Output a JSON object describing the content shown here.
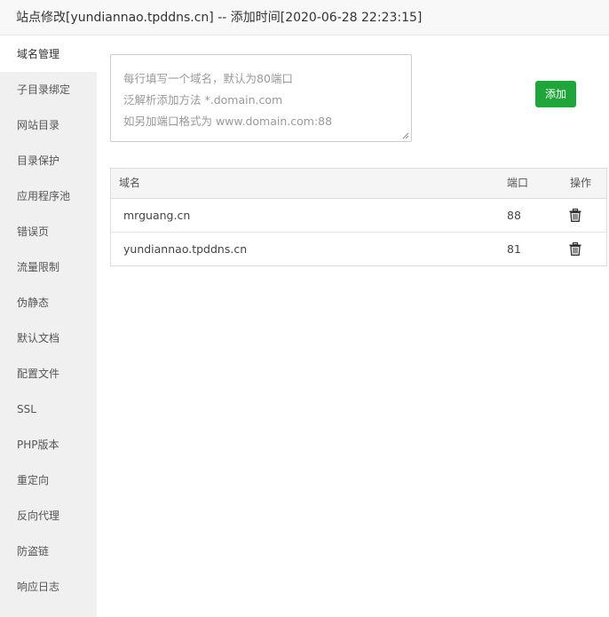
{
  "title": "站点修改[yundiannao.tpddns.cn] -- 添加时间[2020-06-28 22:23:15]",
  "sidebar": {
    "items": [
      {
        "label": "域名管理",
        "active": true
      },
      {
        "label": "子目录绑定"
      },
      {
        "label": "网站目录"
      },
      {
        "label": "目录保护"
      },
      {
        "label": "应用程序池"
      },
      {
        "label": "错误页"
      },
      {
        "label": "流量限制"
      },
      {
        "label": "伪静态"
      },
      {
        "label": "默认文档"
      },
      {
        "label": "配置文件"
      },
      {
        "label": "SSL"
      },
      {
        "label": "PHP版本"
      },
      {
        "label": "重定向"
      },
      {
        "label": "反向代理"
      },
      {
        "label": "防盗链"
      },
      {
        "label": "响应日志"
      }
    ]
  },
  "domain_input": {
    "placeholder_lines": [
      "每行填写一个域名，默认为80端口",
      "泛解析添加方法 *.domain.com",
      "如另加端口格式为 www.domain.com:88"
    ],
    "value": ""
  },
  "add_button": {
    "label": "添加",
    "color": "#20a53a"
  },
  "table": {
    "headers": {
      "domain": "域名",
      "port": "端口",
      "action": "操作"
    },
    "rows": [
      {
        "domain": "mrguang.cn",
        "port": "88",
        "action_icon": "trash-icon"
      },
      {
        "domain": "yundiannao.tpddns.cn",
        "port": "81",
        "action_icon": "trash-icon"
      }
    ]
  }
}
